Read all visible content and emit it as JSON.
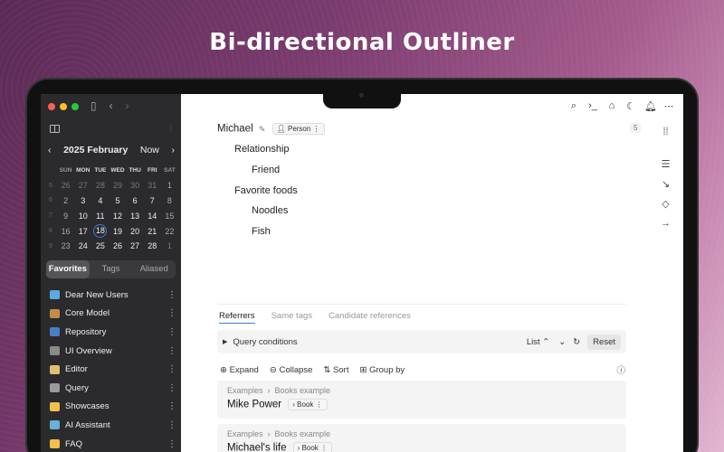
{
  "headline": "Bi-directional Outliner",
  "calendar": {
    "title": "2025 February",
    "now_label": "Now",
    "weekdays": [
      "SUN",
      "MON",
      "TUE",
      "WED",
      "THU",
      "FRI",
      "SAT"
    ],
    "weeks": [
      {
        "wk": "5",
        "days": [
          "26",
          "27",
          "28",
          "29",
          "30",
          "31",
          "1"
        ]
      },
      {
        "wk": "6",
        "days": [
          "2",
          "3",
          "4",
          "5",
          "6",
          "7",
          "8"
        ]
      },
      {
        "wk": "7",
        "days": [
          "9",
          "10",
          "11",
          "12",
          "13",
          "14",
          "15"
        ]
      },
      {
        "wk": "8",
        "days": [
          "16",
          "17",
          "18",
          "19",
          "20",
          "21",
          "22"
        ]
      },
      {
        "wk": "9",
        "days": [
          "23",
          "24",
          "25",
          "26",
          "27",
          "28",
          "1"
        ]
      }
    ]
  },
  "sidebar_tabs": [
    "Favorites",
    "Tags",
    "Aliased"
  ],
  "favorites": [
    {
      "label": "Dear New Users",
      "color": "#5aa9e6"
    },
    {
      "label": "Core Model",
      "color": "#c58b4a"
    },
    {
      "label": "Repository",
      "color": "#4a7fc5"
    },
    {
      "label": "UI Overview",
      "color": "#8a8a8a"
    },
    {
      "label": "Editor",
      "color": "#e0c070"
    },
    {
      "label": "Query",
      "color": "#9a9a9a"
    },
    {
      "label": "Showcases",
      "color": "#f2c04a"
    },
    {
      "label": "AI Assistant",
      "color": "#6ab0d8"
    },
    {
      "label": "FAQ",
      "color": "#f2c04a"
    }
  ],
  "outline": {
    "root": "Michael",
    "root_tag": "Person",
    "ref_count": "5",
    "children": [
      {
        "label": "Relationship",
        "level": 1
      },
      {
        "label": "Friend",
        "level": 2
      },
      {
        "label": "Favorite foods",
        "level": 1
      },
      {
        "label": "Noodles",
        "level": 2
      },
      {
        "label": "Fish",
        "level": 2
      }
    ]
  },
  "ref_tabs": [
    "Referrers",
    "Same tags",
    "Candidate references"
  ],
  "query": {
    "label": "Query conditions",
    "view": "List",
    "reset": "Reset"
  },
  "actions": [
    "Expand",
    "Collapse",
    "Sort",
    "Group by"
  ],
  "references": [
    {
      "crumb_parent": "Examples",
      "crumb_child": "Books example",
      "title": "Mike Power",
      "tag": "Book"
    },
    {
      "crumb_parent": "Examples",
      "crumb_child": "Books example",
      "title": "Michael's life",
      "tag": "Book"
    }
  ]
}
